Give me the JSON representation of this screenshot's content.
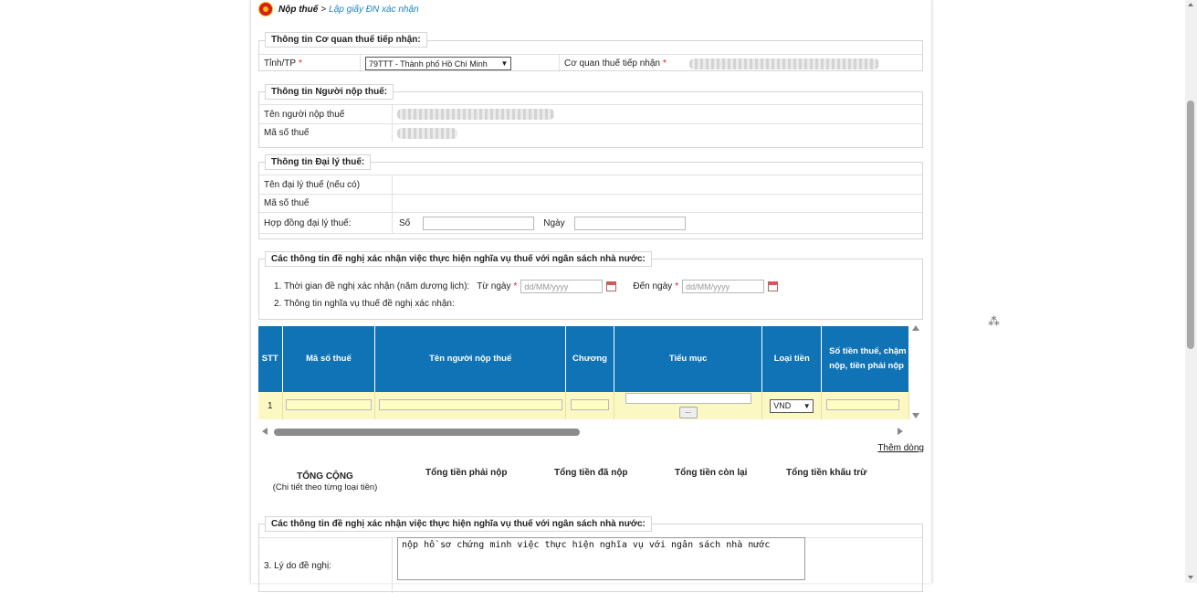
{
  "breadcrumb": {
    "root": "Nộp thuế",
    "separator": ">",
    "current": "Lập giấy ĐN xác nhận"
  },
  "tax_office_section": {
    "title": "Thông tin Cơ quan thuế tiếp nhận:",
    "province_label": "Tỉnh/TP",
    "province_value": "79TTT - Thành phố Hồ Chí Minh",
    "office_label": "Cơ quan thuế tiếp nhận",
    "required_mark": "*"
  },
  "taxpayer_section": {
    "title": "Thông tin Người nộp thuế:",
    "name_label": "Tên người nộp thuế",
    "tax_code_label": "Mã số thuế"
  },
  "agent_section": {
    "title": "Thông tin Đại lý thuế:",
    "name_label": "Tên đại lý thuế (nếu có)",
    "tax_code_label": "Mã số thuế",
    "contract_label": "Hợp đồng đại lý thuế:",
    "number_label": "Số",
    "date_label": "Ngày"
  },
  "request_section": {
    "title": "Các thông tin đề nghị xác nhận việc thực hiện nghĩa vụ thuế với ngân sách nhà nước:",
    "period_label": "1. Thời gian đề nghị xác nhận (năm dương lịch):",
    "from_label": "Từ ngày",
    "to_label": "Đến ngày",
    "date_placeholder": "dd/MM/yyyy",
    "obligation_label": "2. Thông tin nghĩa vụ thuế đề nghị xác nhận:"
  },
  "grid": {
    "headers": [
      "STT",
      "Mã số thuế",
      "Tên người nộp thuế",
      "Chương",
      "Tiểu mục",
      "Loại tiền",
      "Số tiền thuế, chậm nộp, tiền phải nộp"
    ],
    "row": {
      "stt": "1",
      "currency": "VND",
      "picker_label": "..."
    }
  },
  "add_row_link": "Thêm dòng",
  "totals": {
    "title": "TỔNG CỘNG",
    "subtitle": "(Chi tiết theo từng loại tiền)",
    "payable": "Tổng tiền phải nộp",
    "paid": "Tổng tiền đã nộp",
    "remaining": "Tổng tiền còn lại",
    "deducted": "Tổng tiền khấu trừ"
  },
  "reason_section": {
    "title": "Các thông tin đề nghị xác nhận việc thực hiện nghĩa vụ thuế với ngân sách nhà nước:",
    "label": "3. Lý do đề nghị:",
    "value": "nộp hồ sơ chứng minh việc thực hiện nghĩa vụ với ngân sách nhà nước"
  },
  "colors": {
    "header_blue": "#0f73b5",
    "row_yellow": "#fbf8c4",
    "link_blue": "#1a86c8",
    "required_red": "#e11"
  }
}
